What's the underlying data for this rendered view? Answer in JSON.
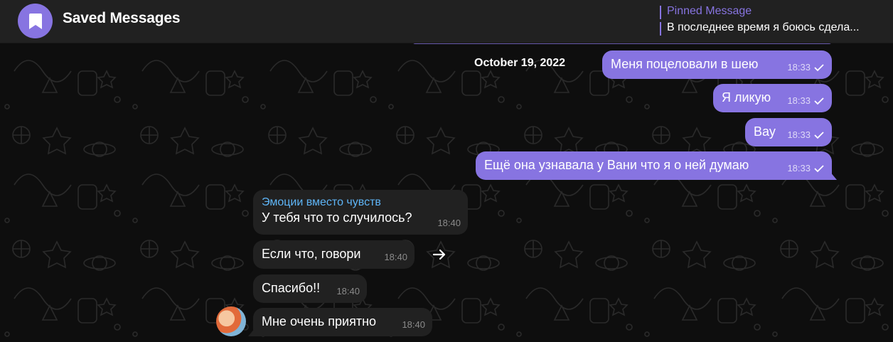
{
  "header": {
    "title": "Saved Messages",
    "avatar_icon": "bookmark-icon",
    "pinned_title": "Pinned Message",
    "pinned_text": "В последнее время я боюсь сдела..."
  },
  "date_divider": "October 19, 2022",
  "outgoing": [
    {
      "text": "Меня поцеловали в шею",
      "time": "18:33"
    },
    {
      "text": "Я ликую",
      "time": "18:33"
    },
    {
      "text": "Вау",
      "time": "18:33"
    },
    {
      "text": "Ещё она узнавала у Вани что я о ней думаю",
      "time": "18:33"
    }
  ],
  "incoming": [
    {
      "sender": "Эмоции вместо чувств",
      "text": "У тебя что то случилось?",
      "time": "18:40"
    },
    {
      "text": "Если что, говори",
      "time": "18:40"
    },
    {
      "text": "Спасибо!!",
      "time": "18:40"
    },
    {
      "text": "Мне очень приятно",
      "time": "18:40"
    }
  ],
  "colors": {
    "accent": "#8774e1",
    "incoming_bubble": "#212121",
    "header_bg": "#212121",
    "sender_name": "#5eb5f7"
  }
}
